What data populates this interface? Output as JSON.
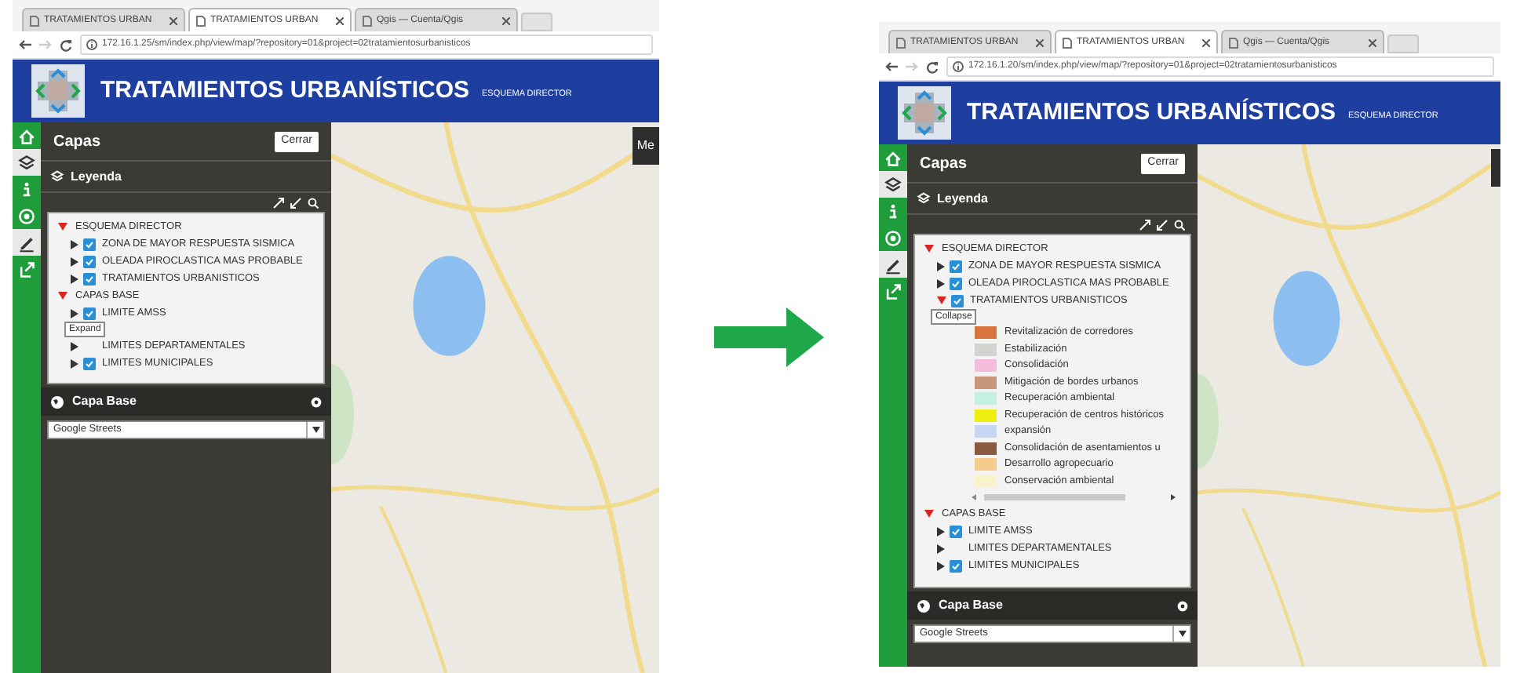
{
  "screens": [
    {
      "tabs": [
        {
          "label": "TRATAMIENTOS URBAN",
          "selected": false
        },
        {
          "label": "TRATAMIENTOS URBAN",
          "selected": true
        },
        {
          "label": "Qgis — Cuenta/Qgis",
          "selected": false
        }
      ],
      "url": "172.16.1.25/sm/index.php/view/map/?repository=01&project=02tratamientosurbanisticos",
      "header": {
        "title": "TRATAMIENTOS URBANÍSTICOS",
        "subtitle": "ESQUEMA DIRECTOR"
      },
      "sidebar": [
        {
          "kind": "home",
          "selected": false
        },
        {
          "kind": "layers",
          "selected": true
        },
        {
          "kind": "info",
          "selected": false
        },
        {
          "kind": "target",
          "selected": false
        },
        {
          "kind": "pencil",
          "selected": true
        },
        {
          "kind": "share",
          "selected": false
        }
      ],
      "panel": {
        "title": "Capas",
        "close_button": "Cerrar",
        "legend_title": "Leyenda",
        "tree": [
          {
            "label": "ESQUEMA DIRECTOR",
            "expanded": true,
            "children": [
              {
                "label": "ZONA DE MAYOR RESPUESTA SISMICA",
                "checked": true,
                "expanded": false
              },
              {
                "label": "OLEADA PIROCLASTICA MAS PROBABLE",
                "checked": true,
                "expanded": false
              },
              {
                "label": "TRATAMIENTOS URBANISTICOS",
                "checked": true,
                "expanded": false
              }
            ]
          },
          {
            "label": "CAPAS BASE",
            "expanded": true,
            "children": [
              {
                "label": "LIMITE AMSS",
                "checked": true,
                "expanded": false,
                "tooltip": "Expand"
              },
              {
                "label": "LIMITES DEPARTAMENTALES",
                "checked": false,
                "expanded": false
              },
              {
                "label": "LIMITES MUNICIPALES",
                "checked": true,
                "expanded": false
              }
            ]
          }
        ],
        "base_layer": {
          "title": "Capa Base",
          "select": "Google Streets"
        }
      },
      "map_button": "Me"
    },
    {
      "tabs": [
        {
          "label": "TRATAMIENTOS URBAN",
          "selected": false
        },
        {
          "label": "TRATAMIENTOS URBAN",
          "selected": true
        },
        {
          "label": "Qgis — Cuenta/Qgis",
          "selected": false
        }
      ],
      "url": "172.16.1.20/sm/index.php/view/map/?repository=01&project=02tratamientosurbanisticos",
      "header": {
        "title": "TRATAMIENTOS URBANÍSTICOS",
        "subtitle": "ESQUEMA DIRECTOR"
      },
      "sidebar": [
        {
          "kind": "home",
          "selected": false
        },
        {
          "kind": "layers",
          "selected": true
        },
        {
          "kind": "info",
          "selected": false
        },
        {
          "kind": "target",
          "selected": false
        },
        {
          "kind": "pencil",
          "selected": true
        },
        {
          "kind": "share",
          "selected": false
        }
      ],
      "panel": {
        "title": "Capas",
        "close_button": "Cerrar",
        "legend_title": "Leyenda",
        "tree": [
          {
            "label": "ESQUEMA DIRECTOR",
            "expanded": true,
            "children": [
              {
                "label": "ZONA DE MAYOR RESPUESTA SISMICA",
                "checked": true,
                "expanded": false
              },
              {
                "label": "OLEADA PIROCLASTICA MAS PROBABLE",
                "checked": true,
                "expanded": false
              },
              {
                "label": "TRATAMIENTOS URBANISTICOS",
                "checked": true,
                "expanded": true,
                "tooltip": "Collapse",
                "legend": [
                  {
                    "label": "Revitalización de corredores",
                    "color": "#d9763f"
                  },
                  {
                    "label": "Estabilización",
                    "color": "#d3d3d0"
                  },
                  {
                    "label": "Consolidación",
                    "color": "#f6bcdc"
                  },
                  {
                    "label": "Mitigación de bordes urbanos",
                    "color": "#c8957a"
                  },
                  {
                    "label": "Recuperación ambiental",
                    "color": "#c4f0e4"
                  },
                  {
                    "label": "Recuperación de centros históricos",
                    "color": "#eeee10"
                  },
                  {
                    "label": "expansión",
                    "color": "#c4d6f2"
                  },
                  {
                    "label": "Consolidación de asentamientos u",
                    "color": "#8a5a40"
                  },
                  {
                    "label": "Desarrollo agropecuario",
                    "color": "#f6cc8e"
                  },
                  {
                    "label": "Conservación ambiental",
                    "color": "#f7f3cc"
                  }
                ]
              }
            ]
          },
          {
            "label": "CAPAS BASE",
            "expanded": true,
            "children": [
              {
                "label": "LIMITE AMSS",
                "checked": true,
                "expanded": false
              },
              {
                "label": "LIMITES DEPARTAMENTALES",
                "checked": false,
                "expanded": false
              },
              {
                "label": "LIMITES MUNICIPALES",
                "checked": true,
                "expanded": false
              }
            ]
          }
        ],
        "base_layer": {
          "title": "Capa Base",
          "select": "Google Streets"
        }
      }
    }
  ]
}
